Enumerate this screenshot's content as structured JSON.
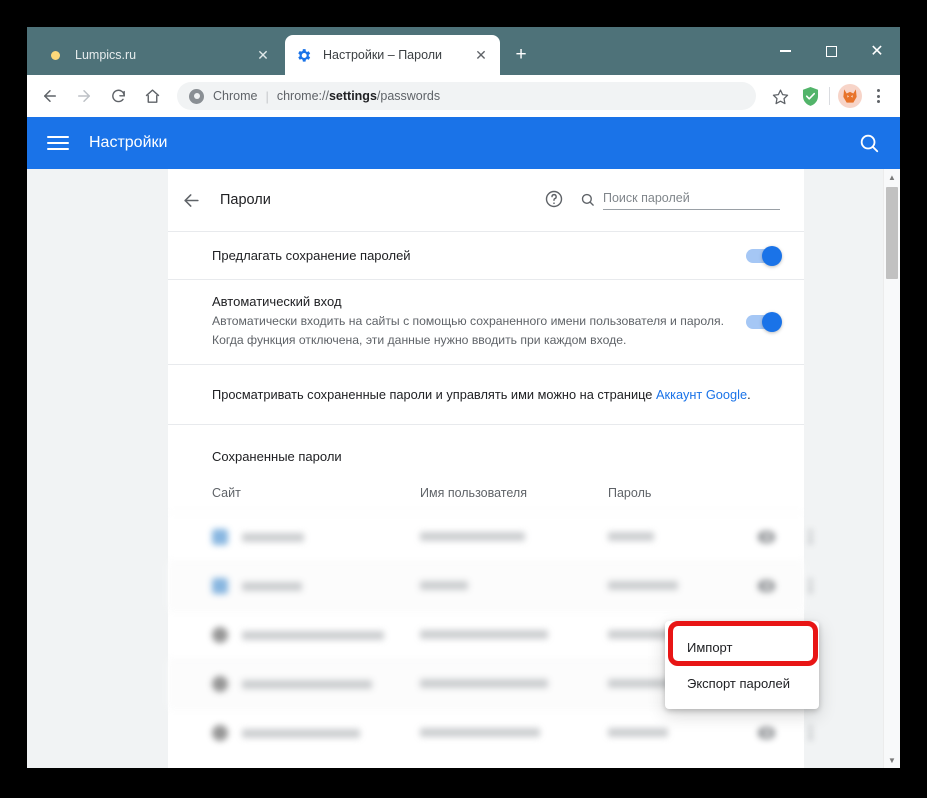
{
  "browser": {
    "tabs": [
      {
        "title": "Lumpics.ru",
        "favicon": "sun-icon",
        "active": false,
        "close_label": "✕"
      },
      {
        "title": "Настройки – Пароли",
        "favicon": "gear-icon",
        "active": true,
        "close_label": "✕"
      }
    ],
    "new_tab_label": "+",
    "window_controls": {
      "minimize": "–",
      "maximize": "□",
      "close": "✕"
    },
    "nav": {
      "back": "←",
      "forward": "→",
      "reload": "↻",
      "home": "⌂"
    },
    "omnibox": {
      "scheme_label": "Chrome",
      "separator": "|",
      "url_prefix": "chrome://",
      "url_bold": "settings",
      "url_suffix": "/passwords"
    },
    "toolbar_icons": [
      "star-icon",
      "adguard-shield-icon",
      "profile-avatar",
      "chrome-menu-icon"
    ],
    "titlebar_color": "#4e7279"
  },
  "settings_bar": {
    "menu_label": "≡",
    "title": "Настройки",
    "search_icon": "search-icon",
    "color": "#1a73e8"
  },
  "page": {
    "back_arrow": "←",
    "title": "Пароли",
    "help_icon": "help-circle-icon",
    "search_placeholder": "Поиск паролей",
    "settings_rows": [
      {
        "title": "Предлагать сохранение паролей",
        "subtitle": "",
        "toggle_on": true
      },
      {
        "title": "Автоматический вход",
        "subtitle": "Автоматически входить на сайты с помощью сохраненного имени пользователя и пароля. Когда функция отключена, эти данные нужно вводить при каждом входе.",
        "toggle_on": true
      }
    ],
    "account_notice": {
      "text_before": "Просматривать сохраненные пароли и управлять ими можно на странице ",
      "link_text": "Аккаунт Google",
      "text_after": "."
    },
    "saved_passwords_heading": "Сохраненные пароли",
    "table": {
      "headers": {
        "site": "Сайт",
        "username": "Имя пользователя",
        "password": "Пароль"
      },
      "rows": [
        {
          "favicon": "blue",
          "site_width": 62,
          "user_width": 105,
          "pass_width": 46
        },
        {
          "favicon": "blue",
          "site_width": 60,
          "user_width": 48,
          "pass_width": 70
        },
        {
          "favicon": "grey",
          "site_width": 142,
          "user_width": 128,
          "pass_width": 62
        },
        {
          "favicon": "grey",
          "site_width": 130,
          "user_width": 128,
          "pass_width": 62
        },
        {
          "favicon": "grey",
          "site_width": 118,
          "user_width": 120,
          "pass_width": 60
        }
      ],
      "row_icons": {
        "reveal": "eye-icon",
        "more": "more-vertical-icon"
      }
    },
    "menu": {
      "items": [
        {
          "label": "Импорт",
          "highlighted": true
        },
        {
          "label": "Экспорт паролей",
          "highlighted": false
        }
      ],
      "highlight_color": "#e81515"
    },
    "scrollbar": {
      "up": "▲",
      "down": "▼"
    }
  }
}
